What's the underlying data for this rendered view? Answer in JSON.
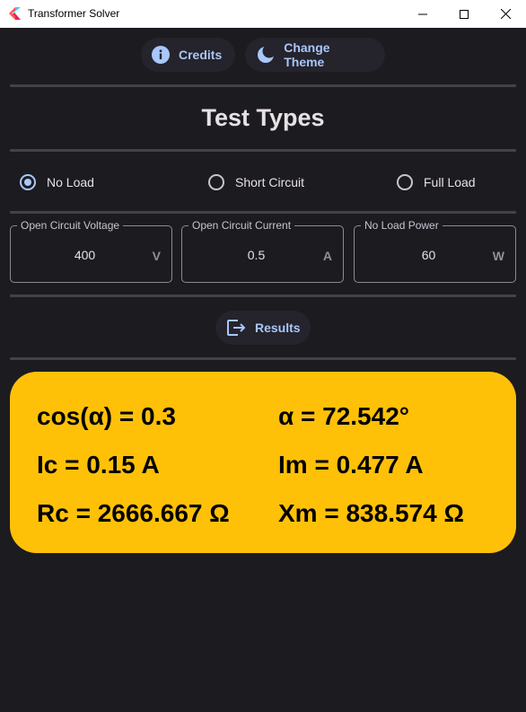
{
  "window": {
    "title": "Transformer Solver"
  },
  "toolbar": {
    "credits_label": "Credits",
    "theme_label": "Change Theme"
  },
  "heading": "Test Types",
  "test_types": [
    {
      "label": "No Load",
      "selected": true
    },
    {
      "label": "Short Circuit",
      "selected": false
    },
    {
      "label": "Full Load",
      "selected": false
    }
  ],
  "inputs": [
    {
      "label": "Open Circuit Voltage",
      "value": "400",
      "unit": "V"
    },
    {
      "label": "Open Circuit Current",
      "value": "0.5",
      "unit": "A"
    },
    {
      "label": "No Load Power",
      "value": "60",
      "unit": "W"
    }
  ],
  "results_button": "Results",
  "results": {
    "cos_alpha": "cos(α) = 0.3",
    "alpha": "α = 72.542°",
    "ic": "Ic = 0.15 A",
    "im": "Im = 0.477 A",
    "rc": "Rc = 2666.667 Ω",
    "xm": "Xm = 838.574 Ω"
  },
  "colors": {
    "background": "#1c1b1f",
    "accent": "#a8c7fa",
    "result_card": "#ffc107"
  },
  "icons": {
    "credits": "info-icon",
    "theme": "moon-icon",
    "results": "export-icon"
  }
}
